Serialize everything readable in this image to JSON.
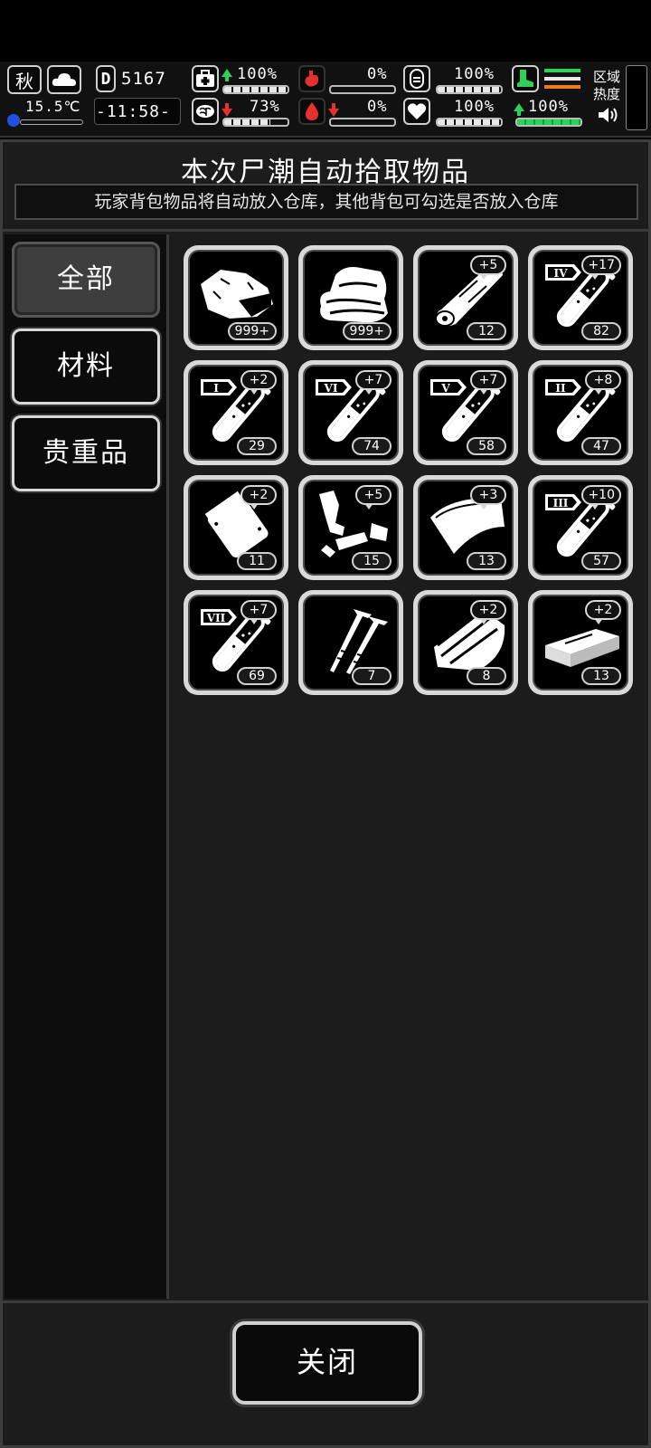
{
  "hud": {
    "season": "秋",
    "temperature": "15.5℃",
    "day": "5167",
    "time": "-11:58-",
    "region_label": "区域\n热度",
    "stats": [
      {
        "name": "health",
        "value": "100%",
        "trend": "up"
      },
      {
        "name": "stomach",
        "value": "0%",
        "trend": "none"
      },
      {
        "name": "stamina",
        "value": "100%",
        "trend": "none"
      },
      {
        "name": "brain",
        "value": "73%",
        "trend": "down"
      },
      {
        "name": "blood",
        "value": "0%",
        "trend": "down"
      },
      {
        "name": "mood",
        "value": "100%",
        "trend": "none"
      },
      {
        "name": "move",
        "value": "100%",
        "trend": "up"
      }
    ],
    "colors": {
      "accent_green": "#2fd05a",
      "accent_red": "#e53030",
      "accent_orange": "#f07a1a"
    }
  },
  "panel": {
    "title": "本次尸潮自动拾取物品",
    "subtitle": "玩家背包物品将自动放入仓库，其他背包可勾选是否放入仓库"
  },
  "categories": [
    "全部",
    "材料",
    "贵重品"
  ],
  "items": [
    {
      "icon": "stone-icon",
      "count": "999+",
      "bonus": ""
    },
    {
      "icon": "cloth-icon",
      "count": "999+",
      "bonus": ""
    },
    {
      "icon": "wood-log-icon",
      "count": "12",
      "bonus": "+5"
    },
    {
      "icon": "test-tube-iv-icon",
      "roman": "IV",
      "count": "82",
      "bonus": "+17"
    },
    {
      "icon": "test-tube-i-icon",
      "roman": "I",
      "count": "29",
      "bonus": "+2"
    },
    {
      "icon": "test-tube-vi-icon",
      "roman": "VI",
      "count": "74",
      "bonus": "+7"
    },
    {
      "icon": "test-tube-v-icon",
      "roman": "V",
      "count": "58",
      "bonus": "+7"
    },
    {
      "icon": "test-tube-ii-icon",
      "roman": "II",
      "count": "47",
      "bonus": "+8"
    },
    {
      "icon": "plastic-bag-icon",
      "count": "11",
      "bonus": "+2"
    },
    {
      "icon": "scrap-parts-icon",
      "count": "15",
      "bonus": "+5"
    },
    {
      "icon": "leather-sheet-icon",
      "count": "13",
      "bonus": "+3"
    },
    {
      "icon": "test-tube-iii-icon",
      "roman": "III",
      "count": "57",
      "bonus": "+10"
    },
    {
      "icon": "test-tube-vii-icon",
      "roman": "VII",
      "count": "69",
      "bonus": "+7"
    },
    {
      "icon": "nails-icon",
      "count": "7",
      "bonus": ""
    },
    {
      "icon": "wood-planks-icon",
      "count": "8",
      "bonus": "+2"
    },
    {
      "icon": "steel-ingot-icon",
      "count": "13",
      "bonus": "+2"
    }
  ],
  "footer": {
    "close_label": "关闭"
  }
}
